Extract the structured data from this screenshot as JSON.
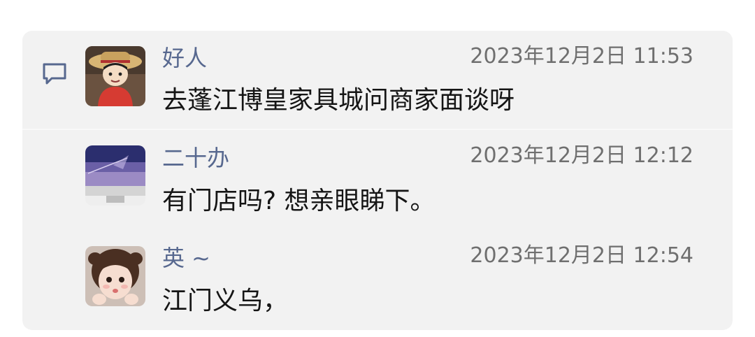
{
  "comments": [
    {
      "author": "好人",
      "time": "2023年12月2日 11:53",
      "text": "去蓬江博皇家具城问商家面谈呀",
      "avatar_icon": "cartoon-boy-straw-hat-avatar"
    },
    {
      "author": "二十办",
      "time": "2023年12月2日 12:12",
      "text": "有门店吗? 想亲眼睇下。",
      "avatar_icon": "computer-monitor-avatar"
    },
    {
      "author": "英 ~",
      "time": "2023年12月2日 12:54",
      "text": "江门义乌，",
      "avatar_icon": "little-girl-photo-avatar"
    }
  ],
  "icons": {
    "comment": "comment-bubble-icon"
  },
  "colors": {
    "panel_background": "#f2f2f2",
    "author_name": "#57688f",
    "timestamp": "#6f6f6f",
    "message_text": "#151515"
  }
}
